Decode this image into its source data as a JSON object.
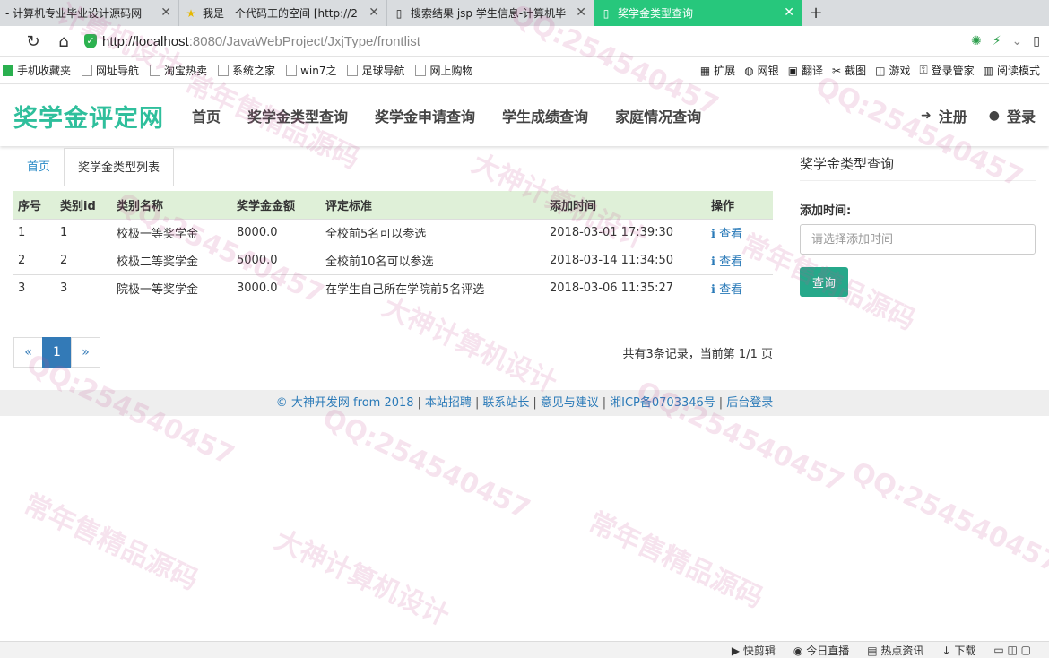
{
  "browser": {
    "tabs": [
      {
        "title": "- 计算机专业毕业设计源码网",
        "active": false
      },
      {
        "title": "我是一个代码工的空间 [http://2",
        "active": false
      },
      {
        "title": "搜索结果 jsp 学生信息-计算机毕",
        "active": false
      },
      {
        "title": "奖学金类型查询",
        "active": true
      }
    ],
    "url_host": "http://localhost",
    "url_rest": ":8080/JavaWebProject/JxjType/frontlist",
    "bookmarks": [
      "手机收藏夹",
      "网址导航",
      "淘宝热卖",
      "系统之家",
      "win7之",
      "足球导航",
      "网上购物"
    ],
    "bookmarks_right": [
      "扩展",
      "网银",
      "翻译",
      "截图",
      "游戏",
      "登录管家",
      "阅读模式"
    ]
  },
  "site": {
    "logo": "奖学金评定网",
    "nav": [
      "首页",
      "奖学金类型查询",
      "奖学金申请查询",
      "学生成绩查询",
      "家庭情况查询"
    ],
    "register": "注册",
    "login": "登录"
  },
  "content": {
    "tab_home": "首页",
    "tab_list": "奖学金类型列表",
    "columns": [
      "序号",
      "类别id",
      "类别名称",
      "奖学金金额",
      "评定标准",
      "添加时间",
      "操作"
    ],
    "rows": [
      {
        "no": "1",
        "id": "1",
        "name": "校极一等奖学金",
        "amount": "8000.0",
        "standard": "全校前5名可以参选",
        "time": "2018-03-01 17:39:30",
        "op": "查看"
      },
      {
        "no": "2",
        "id": "2",
        "name": "校极二等奖学金",
        "amount": "5000.0",
        "standard": "全校前10名可以参选",
        "time": "2018-03-14 11:34:50",
        "op": "查看"
      },
      {
        "no": "3",
        "id": "3",
        "name": "院极一等奖学金",
        "amount": "3000.0",
        "standard": "在学生自己所在学院前5名评选",
        "time": "2018-03-06 11:35:27",
        "op": "查看"
      }
    ],
    "pager": {
      "prev": "«",
      "current": "1",
      "next": "»"
    },
    "pager_info": "共有3条记录，当前第 1/1 页"
  },
  "sidebar": {
    "title": "奖学金类型查询",
    "label": "添加时间:",
    "placeholder": "请选择添加时间",
    "button": "查询"
  },
  "footer": {
    "items": [
      "© 大神开发网 from 2018",
      "本站招聘",
      "联系站长",
      "意见与建议",
      "湘ICP备0703346号",
      "后台登录"
    ]
  },
  "statusbar": [
    "快剪辑",
    "今日直播",
    "热点资讯",
    "下载"
  ],
  "watermark": [
    "计算机设计",
    "QQ:254540457",
    "常年售精品源码",
    "大神计算机设计"
  ],
  "colors": {
    "accent": "#27c77c",
    "logo": "#2fbf9c",
    "table_head": "#dff0d8",
    "button": "#26a88a",
    "link": "#2a7ab8"
  }
}
